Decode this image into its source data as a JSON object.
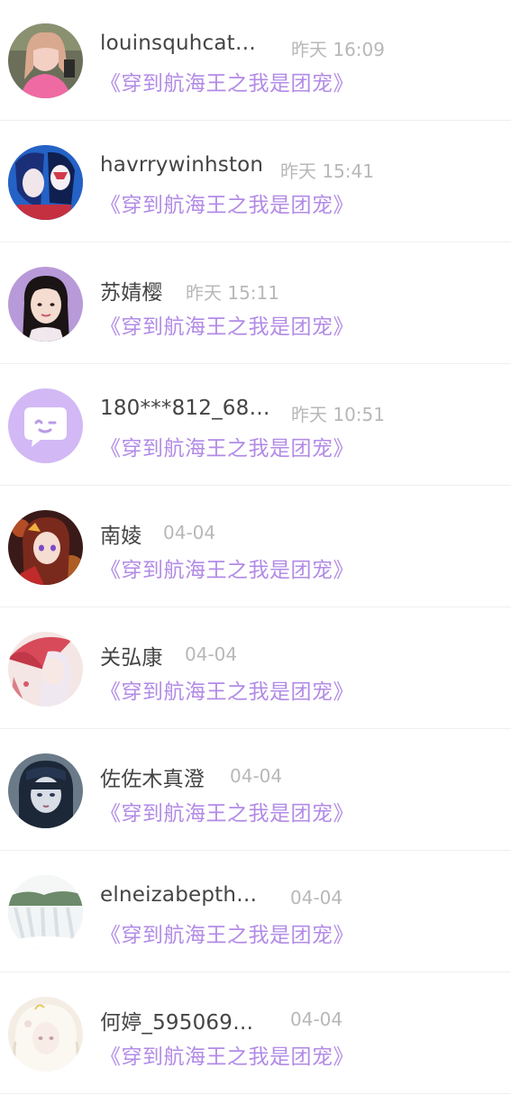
{
  "book_title": "《穿到航海王之我是团宠》",
  "comments": [
    {
      "name": "louinsquhcat…",
      "time": "昨天 16:09",
      "avatar": "avatar-pink-dress-photo"
    },
    {
      "name": "havrrywinhston",
      "time": "昨天 15:41",
      "avatar": "avatar-anime-masked-pair"
    },
    {
      "name": "苏婧樱",
      "time": "昨天 15:11",
      "avatar": "avatar-girl-portrait"
    },
    {
      "name": "180***812_68…",
      "time": "昨天 10:51",
      "avatar": "avatar-default-chat-icon"
    },
    {
      "name": "南婈",
      "time": "04-04",
      "avatar": "avatar-anime-red-girl"
    },
    {
      "name": "关弘康",
      "time": "04-04",
      "avatar": "avatar-anime-umbrella-girl"
    },
    {
      "name": "佐佐木真澄",
      "time": "04-04",
      "avatar": "avatar-dark-hair-portrait"
    },
    {
      "name": "elneizabepth…",
      "time": "04-04",
      "avatar": "avatar-waterfall-landscape"
    },
    {
      "name": "何婷_595069…",
      "time": "04-04",
      "avatar": "avatar-white-hair-anime"
    }
  ],
  "colors": {
    "name": "#444444",
    "time": "#b8b8b8",
    "book_title": "#b28be6",
    "default_avatar_bg": "#d2b8f5"
  }
}
